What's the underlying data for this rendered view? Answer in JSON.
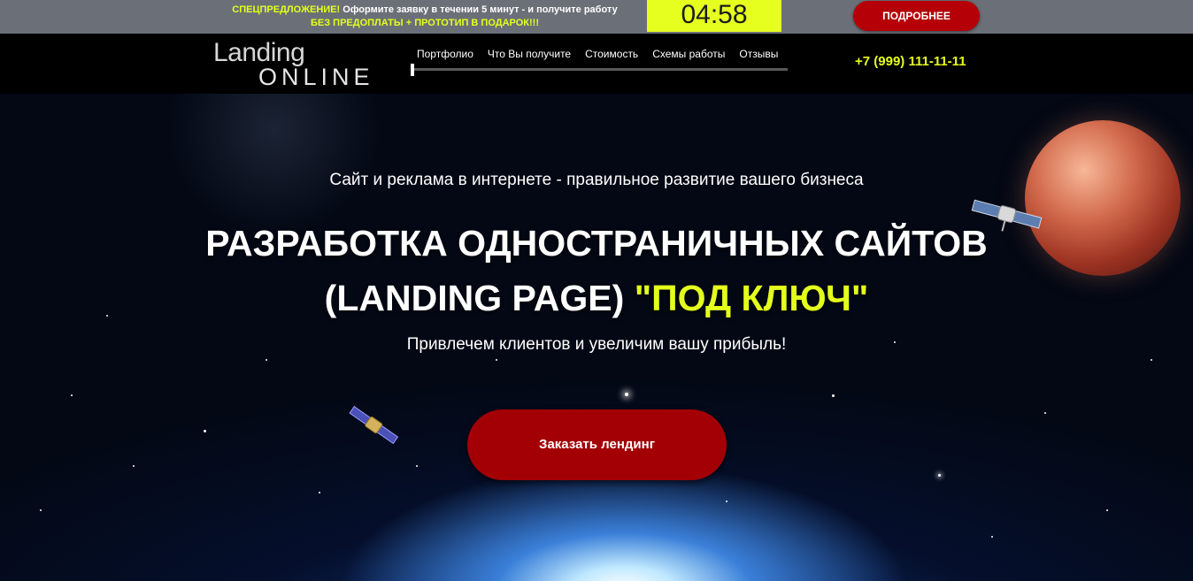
{
  "promo": {
    "special_label": "СПЕЦПРЕДЛОЖЕНИЕ!",
    "line1_rest": " Оформите заявку в течении 5 минут - и получите работу",
    "line2": "БЕЗ ПРЕДОПЛАТЫ + ПРОТОТИП В ПОДАРОК!!!",
    "timer": "04:58",
    "more_button": "ПОДРОБНЕЕ"
  },
  "header": {
    "logo_top": "Landing",
    "logo_bottom": "ONLINE",
    "nav": [
      "Портфолио",
      "Что Вы получите",
      "Стоимость",
      "Схемы работы",
      "Отзывы"
    ],
    "phone": "+7 (999) 111-11-11"
  },
  "hero": {
    "subtitle": "Сайт и реклама в интернете - правильное развитие вашего бизнеса",
    "headline_line1": "РАЗРАБОТКА ОДНОСТРАНИЧНЫХ САЙТОВ",
    "headline_line2_white": "(LANDING PAGE) ",
    "headline_line2_accent": "\"ПОД КЛЮЧ\"",
    "tagline": "Привлечем клиентов и увеличим вашу прибыль!",
    "cta": "Заказать лендинг"
  },
  "colors": {
    "accent": "#e4ff1c",
    "button_red": "#b50007",
    "promo_bg": "#6b7078",
    "header_bg": "#000000"
  },
  "icons": [
    "satellite-icon",
    "planet-image",
    "logo"
  ]
}
